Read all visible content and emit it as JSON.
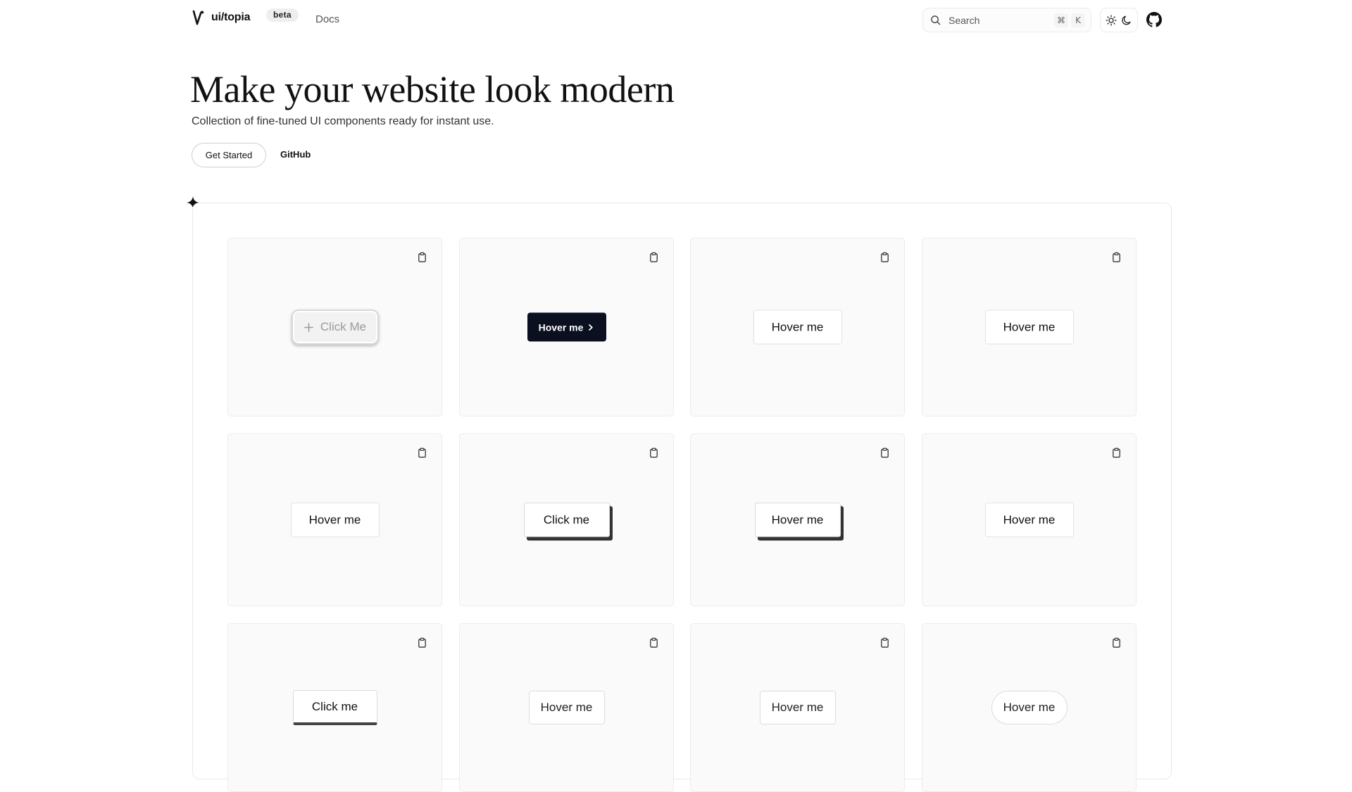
{
  "header": {
    "brand_name": "ui/topia",
    "badge": "beta",
    "nav_docs": "Docs",
    "search_placeholder": "Search",
    "search_shortcut_mod": "⌘",
    "search_shortcut_key": "K"
  },
  "hero": {
    "title": "Make your website look modern",
    "subtitle": "Collection of fine-tuned UI components ready for instant use.",
    "get_started": "Get Started",
    "github": "GitHub"
  },
  "showcase": {
    "cards": [
      {
        "label": "Click Me",
        "style": "click-glass"
      },
      {
        "label": "Hover me",
        "style": "dark-arrow"
      },
      {
        "label": "Hover me",
        "style": "plain"
      },
      {
        "label": "Hover me",
        "style": "plain"
      },
      {
        "label": "Hover me",
        "style": "plain"
      },
      {
        "label": "Click me",
        "style": "shadow"
      },
      {
        "label": "Hover me",
        "style": "shadow"
      },
      {
        "label": "Hover me",
        "style": "plain"
      },
      {
        "label": "Click me",
        "style": "bottom-bar"
      },
      {
        "label": "Hover me",
        "style": "compact"
      },
      {
        "label": "Hover me",
        "style": "compact"
      },
      {
        "label": "Hover me",
        "style": "pill"
      }
    ]
  }
}
